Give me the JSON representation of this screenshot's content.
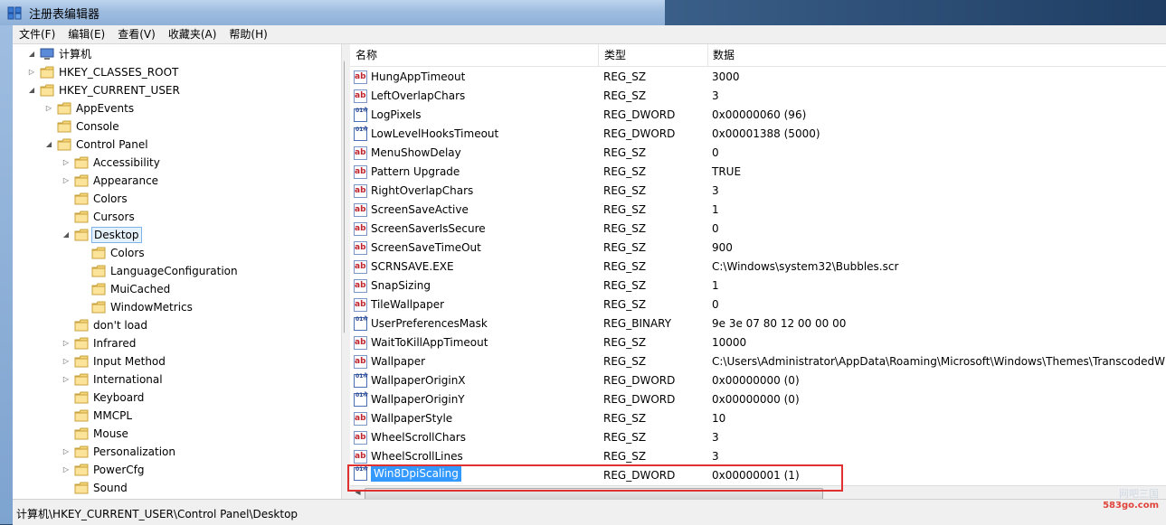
{
  "window": {
    "title": "注册表编辑器"
  },
  "menu": [
    {
      "label": "文件(F)"
    },
    {
      "label": "编辑(E)"
    },
    {
      "label": "查看(V)"
    },
    {
      "label": "收藏夹(A)"
    },
    {
      "label": "帮助(H)"
    }
  ],
  "tree": [
    {
      "label": "计算机",
      "expander": "◢",
      "icon": "computer-icon"
    },
    {
      "label": "HKEY_CLASSES_ROOT",
      "expander": "▷"
    },
    {
      "label": "HKEY_CURRENT_USER",
      "expander": "◢"
    },
    {
      "label": "AppEvents",
      "expander": "▷"
    },
    {
      "label": "Console",
      "expander": ""
    },
    {
      "label": "Control Panel",
      "expander": "◢"
    },
    {
      "label": "Accessibility",
      "expander": "▷"
    },
    {
      "label": "Appearance",
      "expander": "▷"
    },
    {
      "label": "Colors",
      "expander": ""
    },
    {
      "label": "Cursors",
      "expander": ""
    },
    {
      "label": "Desktop",
      "expander": "◢",
      "selected": true
    },
    {
      "label": "Colors",
      "expander": ""
    },
    {
      "label": "LanguageConfiguration",
      "expander": ""
    },
    {
      "label": "MuiCached",
      "expander": ""
    },
    {
      "label": "WindowMetrics",
      "expander": ""
    },
    {
      "label": "don't load",
      "expander": ""
    },
    {
      "label": "Infrared",
      "expander": "▷"
    },
    {
      "label": "Input Method",
      "expander": "▷"
    },
    {
      "label": "International",
      "expander": "▷"
    },
    {
      "label": "Keyboard",
      "expander": ""
    },
    {
      "label": "MMCPL",
      "expander": ""
    },
    {
      "label": "Mouse",
      "expander": ""
    },
    {
      "label": "Personalization",
      "expander": "▷"
    },
    {
      "label": "PowerCfg",
      "expander": "▷"
    },
    {
      "label": "Sound",
      "expander": ""
    }
  ],
  "list": {
    "columns": {
      "name": "名称",
      "type": "类型",
      "data": "数据"
    },
    "rows": [
      {
        "name": "HungAppTimeout",
        "type": "REG_SZ",
        "data": "3000",
        "kind": "sz"
      },
      {
        "name": "LeftOverlapChars",
        "type": "REG_SZ",
        "data": "3",
        "kind": "sz"
      },
      {
        "name": "LogPixels",
        "type": "REG_DWORD",
        "data": "0x00000060 (96)",
        "kind": "bin"
      },
      {
        "name": "LowLevelHooksTimeout",
        "type": "REG_DWORD",
        "data": "0x00001388 (5000)",
        "kind": "bin"
      },
      {
        "name": "MenuShowDelay",
        "type": "REG_SZ",
        "data": "0",
        "kind": "sz"
      },
      {
        "name": "Pattern Upgrade",
        "type": "REG_SZ",
        "data": "TRUE",
        "kind": "sz"
      },
      {
        "name": "RightOverlapChars",
        "type": "REG_SZ",
        "data": "3",
        "kind": "sz"
      },
      {
        "name": "ScreenSaveActive",
        "type": "REG_SZ",
        "data": "1",
        "kind": "sz"
      },
      {
        "name": "ScreenSaverIsSecure",
        "type": "REG_SZ",
        "data": "0",
        "kind": "sz"
      },
      {
        "name": "ScreenSaveTimeOut",
        "type": "REG_SZ",
        "data": "900",
        "kind": "sz"
      },
      {
        "name": "SCRNSAVE.EXE",
        "type": "REG_SZ",
        "data": "C:\\Windows\\system32\\Bubbles.scr",
        "kind": "sz"
      },
      {
        "name": "SnapSizing",
        "type": "REG_SZ",
        "data": "1",
        "kind": "sz"
      },
      {
        "name": "TileWallpaper",
        "type": "REG_SZ",
        "data": "0",
        "kind": "sz"
      },
      {
        "name": "UserPreferencesMask",
        "type": "REG_BINARY",
        "data": "9e 3e 07 80 12 00 00 00",
        "kind": "bin"
      },
      {
        "name": "WaitToKillAppTimeout",
        "type": "REG_SZ",
        "data": "10000",
        "kind": "sz"
      },
      {
        "name": "Wallpaper",
        "type": "REG_SZ",
        "data": "C:\\Users\\Administrator\\AppData\\Roaming\\Microsoft\\Windows\\Themes\\TranscodedW",
        "kind": "sz"
      },
      {
        "name": "WallpaperOriginX",
        "type": "REG_DWORD",
        "data": "0x00000000 (0)",
        "kind": "bin"
      },
      {
        "name": "WallpaperOriginY",
        "type": "REG_DWORD",
        "data": "0x00000000 (0)",
        "kind": "bin"
      },
      {
        "name": "WallpaperStyle",
        "type": "REG_SZ",
        "data": "10",
        "kind": "sz"
      },
      {
        "name": "WheelScrollChars",
        "type": "REG_SZ",
        "data": "3",
        "kind": "sz"
      },
      {
        "name": "WheelScrollLines",
        "type": "REG_SZ",
        "data": "3",
        "kind": "sz"
      },
      {
        "name": "Win8DpiScaling",
        "type": "REG_DWORD",
        "data": "0x00000001 (1)",
        "kind": "bin",
        "selected": true
      }
    ]
  },
  "status": {
    "path": "计算机\\HKEY_CURRENT_USER\\Control Panel\\Desktop"
  },
  "watermark": {
    "line1": "网吧三国",
    "line2": "583go.com"
  },
  "colors": {
    "highlight_red": "#e03030",
    "selection_blue": "#3399ff"
  }
}
